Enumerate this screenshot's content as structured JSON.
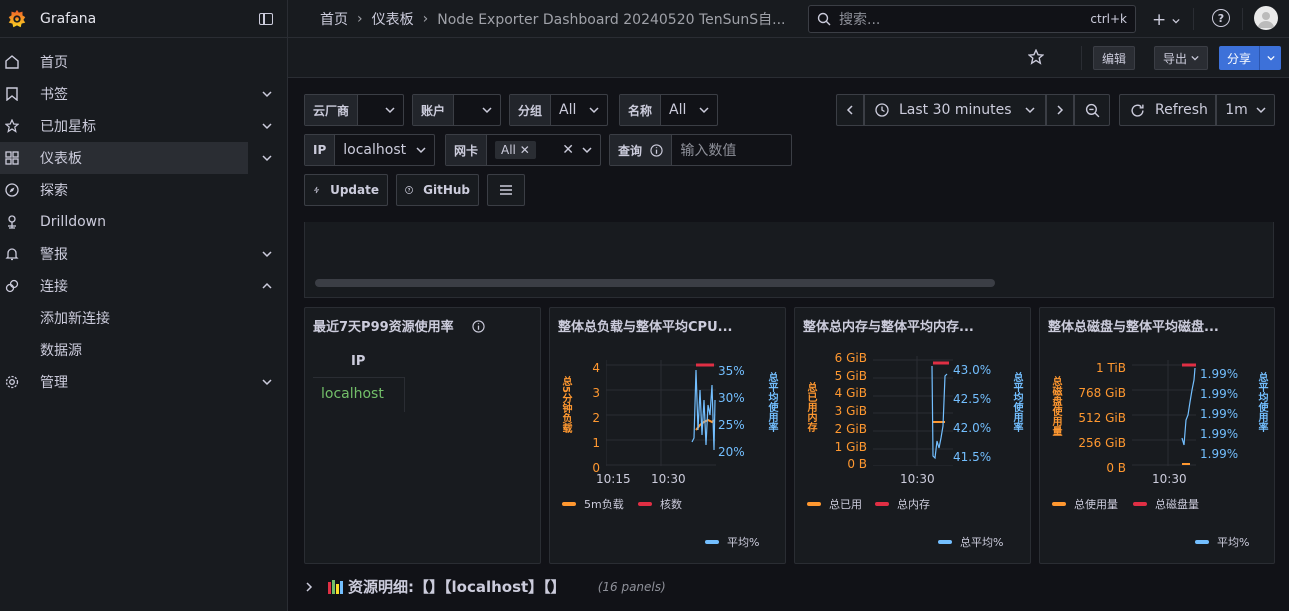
{
  "app": {
    "brand": "Grafana"
  },
  "sidebar": {
    "items": [
      {
        "label": "首页",
        "icon": "home-icon"
      },
      {
        "label": "书签",
        "icon": "bookmark-icon"
      },
      {
        "label": "已加星标",
        "icon": "star-icon"
      },
      {
        "label": "仪表板",
        "icon": "dashboard-grid-icon"
      },
      {
        "label": "探索",
        "icon": "compass-icon"
      },
      {
        "label": "Drilldown",
        "icon": "drilldown-icon"
      },
      {
        "label": "警报",
        "icon": "bell-icon"
      },
      {
        "label": "连接",
        "icon": "link-icon"
      },
      {
        "label": "管理",
        "icon": "gear-icon"
      }
    ],
    "sub_items": [
      "添加新连接",
      "数据源"
    ]
  },
  "topbar": {
    "crumbs": [
      "首页",
      "仪表板",
      "Node Exporter Dashboard 20240520 TenSunS自..."
    ],
    "search_placeholder": "搜索...",
    "search_shortcut": "ctrl+k",
    "plus": "+",
    "help": "?"
  },
  "toolbar": {
    "edit": "编辑",
    "export": "导出",
    "share": "分享"
  },
  "variables": {
    "cloud": {
      "key": "云厂商",
      "value": ""
    },
    "account": {
      "key": "账户",
      "value": ""
    },
    "group": {
      "key": "分组",
      "value": "All"
    },
    "name": {
      "key": "名称",
      "value": "All"
    },
    "ip": {
      "key": "IP",
      "value": "localhost"
    },
    "nic": {
      "key": "网卡",
      "value": "All"
    },
    "query": {
      "key": "查询",
      "placeholder": "输入数值"
    }
  },
  "timepicker": {
    "range": "Last 30 minutes",
    "refresh": "Refresh",
    "interval": "1m"
  },
  "links": {
    "update": "Update",
    "github": "GitHub"
  },
  "panels": {
    "p99": {
      "title": "最近7天P99资源使用率",
      "col": "IP",
      "row": "localhost"
    },
    "cpu": {
      "title": "整体总负载与整体平均CPU...",
      "yleft": [
        "4",
        "3",
        "2",
        "1",
        "0"
      ],
      "yright": [
        "35%",
        "30%",
        "25%",
        "20%"
      ],
      "x": [
        "10:15",
        "10:30"
      ],
      "ylabel_left": "总5分钟负载",
      "ylabel_right": "总平均使用率",
      "legend": [
        "5m负载",
        "核数",
        "平均%"
      ]
    },
    "mem": {
      "title": "整体总内存与整体平均内存...",
      "yleft": [
        "6 GiB",
        "5 GiB",
        "4 GiB",
        "3 GiB",
        "2 GiB",
        "1 GiB",
        "0 B"
      ],
      "yright": [
        "43.0%",
        "42.5%",
        "42.0%",
        "41.5%"
      ],
      "x": [
        "10:30"
      ],
      "ylabel_left": "总已用内存",
      "ylabel_right": "总平均使用率",
      "legend": [
        "总已用",
        "总内存",
        "总平均%"
      ]
    },
    "disk": {
      "title": "整体总磁盘与整体平均磁盘...",
      "yleft": [
        "1 TiB",
        "768 GiB",
        "512 GiB",
        "256 GiB",
        "0 B"
      ],
      "yright": [
        "1.99%",
        "1.99%",
        "1.99%",
        "1.99%",
        "1.99%"
      ],
      "x": [
        "10:30"
      ],
      "ylabel_left": "总磁盘使用量",
      "ylabel_right": "总平均使用率",
      "legend": [
        "总使用量",
        "总磁盘量",
        "平均%"
      ]
    }
  },
  "row": {
    "title": "资源明细:【】【localhost】【】",
    "meta": "(16 panels)"
  },
  "colors": {
    "orange": "#ff9830",
    "red": "#e02f44",
    "blue": "#73bfff",
    "green": "#73bf69",
    "primary": "#3d71d9"
  }
}
